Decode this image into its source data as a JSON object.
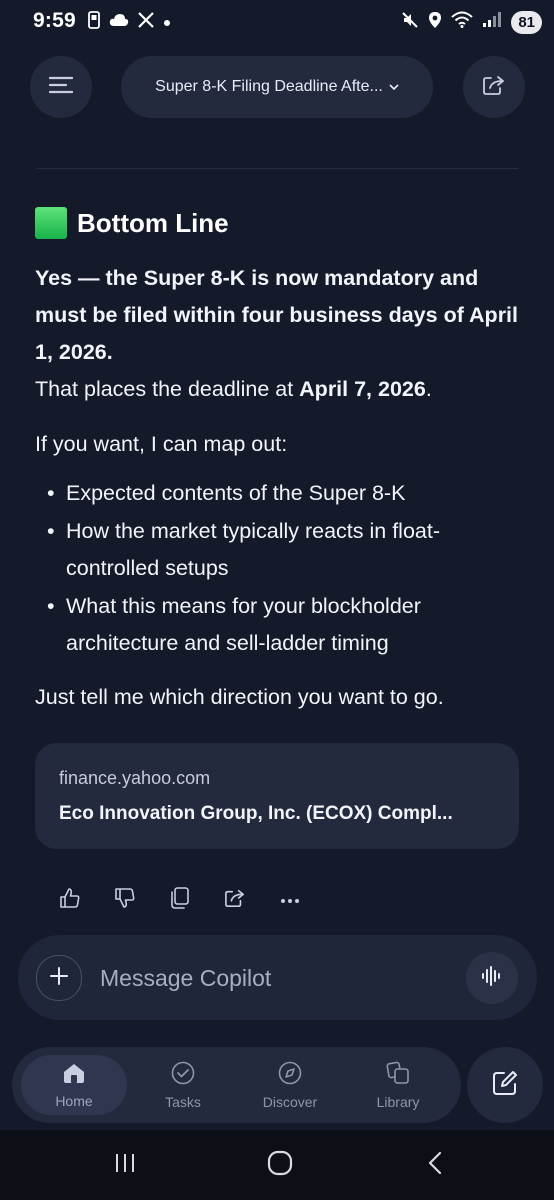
{
  "status_bar": {
    "time": "9:59",
    "battery": "81",
    "left_icons": [
      "phone-storage-icon",
      "cloud-icon",
      "x-logo-icon",
      "dot-icon"
    ],
    "right_icons": [
      "mute-icon",
      "location-icon",
      "wifi-icon",
      "signal-icon"
    ]
  },
  "header": {
    "title": "Super 8-K Filing Deadline Afte...",
    "chevron": "chevron-down-icon"
  },
  "message": {
    "heading": "Bottom Line",
    "bold_lines": "Yes — the Super 8-K is now mandatory and must be filed within four business days of April 1, 2026.",
    "deadline_prefix": "That places the deadline at ",
    "deadline_date": "April 7, 2026",
    "deadline_suffix": ".",
    "map_intro": "If you want, I can map out:",
    "bullets": [
      "Expected contents of the Super 8-K",
      "How the market typically reacts in float-controlled setups",
      "What this means for your blockholder architecture and sell-ladder timing"
    ],
    "closing": "Just tell me which direction you want to go."
  },
  "source": {
    "domain": "finance.yahoo.com",
    "title": "Eco Innovation Group, Inc. (ECOX) Compl..."
  },
  "actions": [
    "thumbs-up-icon",
    "thumbs-down-icon",
    "copy-icon",
    "share-icon",
    "more-icon"
  ],
  "composer": {
    "placeholder": "Message Copilot"
  },
  "nav": {
    "home": "Home",
    "tasks": "Tasks",
    "discover": "Discover",
    "library": "Library",
    "active": "home"
  },
  "colors": {
    "background": "#151a2b",
    "surface": "#242a3d",
    "text": "#f2f4fa",
    "muted": "#8f95ab",
    "accent_green": "#19b24a"
  }
}
